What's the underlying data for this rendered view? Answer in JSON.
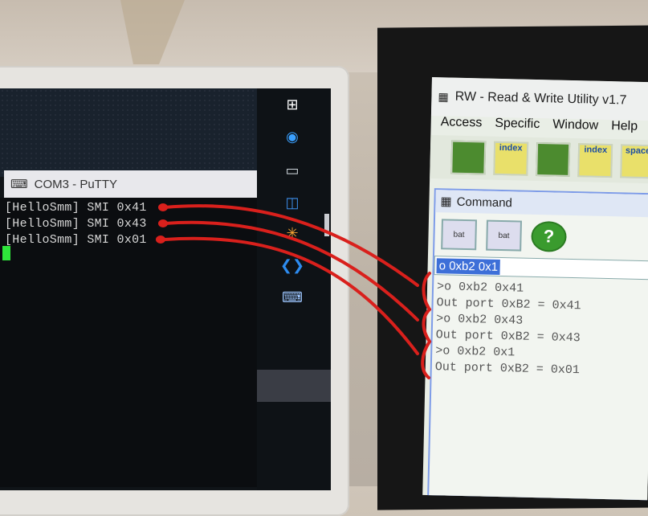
{
  "putty": {
    "title": "COM3 - PuTTY",
    "lines": [
      "[HelloSmm] SMI 0x41",
      "[HelloSmm] SMI 0x43",
      "[HelloSmm] SMI 0x01"
    ]
  },
  "taskbar": {
    "icons": [
      "windows-start-icon",
      "edge-icon",
      "terminal-icon",
      "remote-desktop-icon",
      "file-share-icon",
      "vscode-icon",
      "putty-icon"
    ]
  },
  "rw": {
    "title": "RW - Read & Write Utility v1.7",
    "menu": [
      "Access",
      "Specific",
      "Window",
      "Help"
    ],
    "toolbar": [
      "",
      "index",
      "",
      "index",
      "space"
    ],
    "command_window": {
      "title": "Command",
      "buttons": [
        "bat",
        "bat",
        "?"
      ],
      "input_value": "o 0xb2 0x1",
      "output": [
        ">o 0xb2 0x41",
        "Out port 0xB2 = 0x41",
        ">o 0xb2 0x43",
        "Out port 0xB2 = 0x43",
        ">o 0xb2 0x1",
        "Out port 0xB2 = 0x01"
      ]
    }
  },
  "annotation_color": "#d9201c"
}
